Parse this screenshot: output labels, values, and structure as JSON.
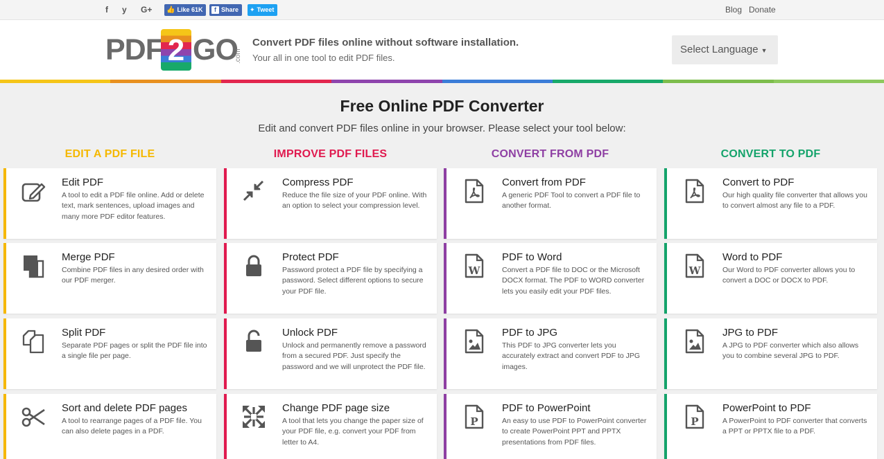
{
  "topbar": {
    "icons": [
      "facebook-icon",
      "twitter-icon",
      "google-plus-icon"
    ],
    "icon_glyphs": [
      "f",
      "y",
      "G+"
    ],
    "like_label": "Like 61K",
    "share_label": "Share",
    "tweet_label": "Tweet",
    "links": [
      "Blog",
      "Donate"
    ]
  },
  "header": {
    "logo": {
      "left": "PDF",
      "two": "2",
      "right": "GO",
      "com": ".com"
    },
    "tagline": "Convert PDF files online without software installation.",
    "subtagline": "Your all in one tool to edit PDF files.",
    "language_label": "Select Language"
  },
  "rainbow_colors": [
    "#f5c518",
    "#e8901f",
    "#e2264e",
    "#8e44ad",
    "#3b7dd8",
    "#18a96a",
    "#7dbd4c",
    "#8ec95e"
  ],
  "main": {
    "title": "Free Online PDF Converter",
    "subtitle": "Edit and convert PDF files online in your browser. Please select your tool below:"
  },
  "columns": [
    {
      "heading": "EDIT A PDF FILE",
      "color": "#f5b800",
      "tools": [
        {
          "title": "Edit PDF",
          "desc": "A tool to edit a PDF file online. Add or delete text, mark sentences, upload images and many more PDF editor features.",
          "icon": "edit-icon"
        },
        {
          "title": "Merge PDF",
          "desc": "Combine PDF files in any desired order with our PDF merger.",
          "icon": "merge-icon"
        },
        {
          "title": "Split PDF",
          "desc": "Separate PDF pages or split the PDF file into a single file per page.",
          "icon": "split-icon"
        },
        {
          "title": "Sort and delete PDF pages",
          "desc": "A tool to rearrange pages of a PDF file. You can also delete pages in a PDF.",
          "icon": "scissors-icon"
        }
      ]
    },
    {
      "heading": "IMPROVE PDF FILES",
      "color": "#e01a4f",
      "tools": [
        {
          "title": "Compress PDF",
          "desc": "Reduce the file size of your PDF online. With an option to select your compression level.",
          "icon": "compress-icon"
        },
        {
          "title": "Protect PDF",
          "desc": "Password protect a PDF file by specifying a password. Select different options to secure your PDF file.",
          "icon": "lock-icon"
        },
        {
          "title": "Unlock PDF",
          "desc": "Unlock and permanently remove a password from a secured PDF. Just specify the password and we will unprotect the PDF file.",
          "icon": "unlock-icon"
        },
        {
          "title": "Change PDF page size",
          "desc": "A tool that lets you change the paper size of your PDF file, e.g. convert your PDF from letter to A4.",
          "icon": "resize-icon"
        }
      ]
    },
    {
      "heading": "CONVERT FROM PDF",
      "color": "#8e3fa3",
      "tools": [
        {
          "title": "Convert from PDF",
          "desc": "A generic PDF Tool to convert a PDF file to another format.",
          "icon": "pdf-file-icon"
        },
        {
          "title": "PDF to Word",
          "desc": "Convert a PDF file to DOC or the Microsoft DOCX format. The PDF to WORD converter lets you easily edit your PDF files.",
          "icon": "word-file-icon"
        },
        {
          "title": "PDF to JPG",
          "desc": "This PDF to JPG converter lets you accurately extract and convert PDF to JPG images.",
          "icon": "image-file-icon"
        },
        {
          "title": "PDF to PowerPoint",
          "desc": "An easy to use PDF to PowerPoint converter to create PowerPoint PPT and PPTX presentations from PDF files.",
          "icon": "powerpoint-file-icon"
        }
      ]
    },
    {
      "heading": "CONVERT TO PDF",
      "color": "#14a36b",
      "tools": [
        {
          "title": "Convert to PDF",
          "desc": "Our high quality file converter that allows you to convert almost any file to a PDF.",
          "icon": "pdf-file-icon"
        },
        {
          "title": "Word to PDF",
          "desc": "Our Word to PDF converter allows you to convert a DOC or DOCX to PDF.",
          "icon": "word-file-icon"
        },
        {
          "title": "JPG to PDF",
          "desc": "A JPG to PDF converter which also allows you to combine several JPG to PDF.",
          "icon": "image-file-icon"
        },
        {
          "title": "PowerPoint to PDF",
          "desc": "A PowerPoint to PDF converter that converts a PPT or PPTX file to a PDF.",
          "icon": "powerpoint-file-icon"
        }
      ]
    }
  ]
}
